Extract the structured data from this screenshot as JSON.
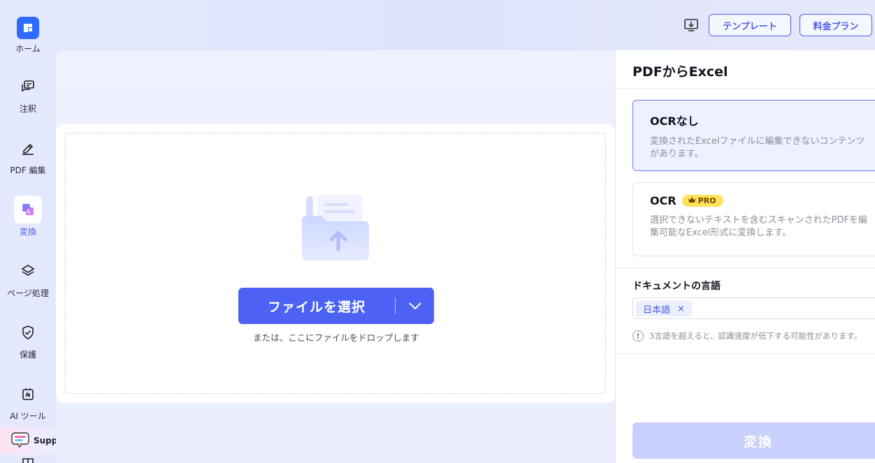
{
  "sidebar": {
    "items": [
      {
        "label": "ホーム",
        "icon": "home-logo-icon"
      },
      {
        "label": "注釈",
        "icon": "annotation-icon"
      },
      {
        "label": "PDF 編集",
        "icon": "edit-pen-icon"
      },
      {
        "label": "変換",
        "icon": "convert-icon",
        "active": true
      },
      {
        "label": "ページ処理",
        "icon": "layers-icon"
      },
      {
        "label": "保護",
        "icon": "shield-check-icon"
      },
      {
        "label": "AI ツール",
        "icon": "ai-tools-icon"
      }
    ],
    "support_label": "Support"
  },
  "topbar": {
    "template_label": "テンプレート",
    "pricing_label": "料金プラン",
    "download_icon": "download-icon"
  },
  "dropzone": {
    "select_label": "ファイルを選択",
    "hint": "または、ここにファイルをドロップします"
  },
  "panel": {
    "title": "PDFからExcel",
    "option_no_ocr": {
      "title": "OCRなし",
      "desc_line1": "変換されたExcelファイルに編集できないコンテンツ",
      "desc_line2": "があります。"
    },
    "option_ocr": {
      "title": "OCR",
      "badge": "PRO",
      "desc_line1": "選択できないテキストを含むスキャンされたPDFを編",
      "desc_line2": "集可能なExcel形式に変換します。"
    },
    "language_label": "ドキュメントの言語",
    "language_tag": "日本語",
    "language_remove": "×",
    "warning_symbol": "!",
    "warning": "3言語を超えると、認識速度が低下する可能性があります。",
    "convert_label": "変換"
  },
  "colors": {
    "accent": "#4b62f5",
    "pro_badge": "#ffe15a",
    "convert_disabled": "#c9d0fc"
  }
}
